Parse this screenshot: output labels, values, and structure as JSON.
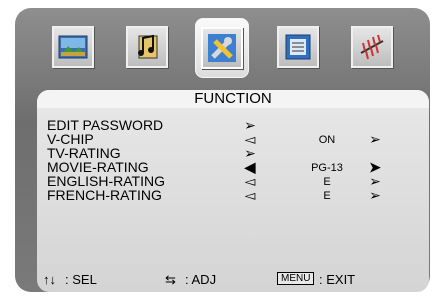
{
  "tabs": [
    {
      "icon": "picture-icon",
      "selected": false
    },
    {
      "icon": "music-note-icon",
      "selected": false
    },
    {
      "icon": "tools-icon",
      "selected": true
    },
    {
      "icon": "document-icon",
      "selected": false
    },
    {
      "icon": "antenna-icon",
      "selected": false
    }
  ],
  "title": "FUNCTION",
  "rows": [
    {
      "label": "EDIT PASSWORD",
      "value": ""
    },
    {
      "label": "V-CHIP",
      "value": "ON"
    },
    {
      "label": "TV-RATING",
      "value": ""
    },
    {
      "label": "MOVIE-RATING",
      "value": "PG-13"
    },
    {
      "label": "ENGLISH-RATING",
      "value": "E"
    },
    {
      "label": "FRENCH-RATING",
      "value": "E"
    }
  ],
  "footer": {
    "sel_label": ": SEL",
    "adj_label": ": ADJ",
    "menu_key": "MENU",
    "exit_label": ": EXIT"
  }
}
